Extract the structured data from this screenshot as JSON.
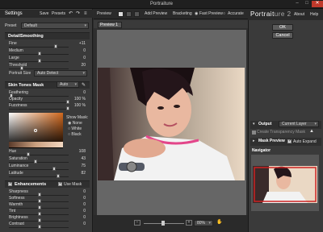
{
  "app": {
    "title": "Portraiture"
  },
  "left_panel": {
    "header": {
      "title": "Settings",
      "save": "Save",
      "presets": "Presets"
    },
    "preset": {
      "label": "Preset",
      "value": "Default"
    },
    "detail": {
      "title": "DetailSmoothing",
      "sliders": [
        {
          "name": "Fine",
          "value": "+11",
          "pos": 0.78
        },
        {
          "name": "Medium",
          "value": "0",
          "pos": 0.5
        },
        {
          "name": "Large",
          "value": "0",
          "pos": 0.5
        },
        {
          "name": "Threshold",
          "value": "20",
          "pos": 0.2
        }
      ],
      "portrait_size": {
        "label": "Portrait Size",
        "value": "Auto Detect"
      }
    },
    "skin": {
      "title": "Skin Tones Mask",
      "mode": "Auto",
      "sliders": [
        {
          "name": "Feathering",
          "value": "0",
          "pos": 0.02
        },
        {
          "name": "Opacity",
          "value": "100 %",
          "pos": 0.98
        },
        {
          "name": "Fuzziness",
          "value": "100 %",
          "pos": 0.98
        }
      ],
      "show_mask": {
        "label": "Show Mask:",
        "options": [
          "None",
          "White",
          "Black"
        ],
        "selected": 0
      },
      "hsl": [
        {
          "name": "Hue",
          "value": "108",
          "pos": 0.3
        },
        {
          "name": "Saturation",
          "value": "43",
          "pos": 0.43
        },
        {
          "name": "Luminance",
          "value": "75",
          "pos": 0.75
        },
        {
          "name": "Latitude",
          "value": "82",
          "pos": 0.82
        }
      ]
    },
    "enh": {
      "title": "Enhancements",
      "use_mask": "Use Mask",
      "sliders": [
        {
          "name": "Sharpness",
          "value": "0",
          "pos": 0.5
        },
        {
          "name": "Softness",
          "value": "0",
          "pos": 0.5
        },
        {
          "name": "Warmth",
          "value": "0",
          "pos": 0.5
        },
        {
          "name": "Tint",
          "value": "0",
          "pos": 0.5
        },
        {
          "name": "Brightness",
          "value": "0",
          "pos": 0.5
        },
        {
          "name": "Contrast",
          "value": "0",
          "pos": 0.5
        }
      ]
    }
  },
  "preview": {
    "label": "Preview",
    "add_preview": "Add Preview",
    "bracketing": "Bracketing",
    "fast_preview": "Fast Preview",
    "accurate": "Accurate",
    "tab": "Preview 1",
    "zoom": "80%"
  },
  "right_panel": {
    "brand_prefix": "Portrait",
    "brand_suffix": "ure 2",
    "about": "About",
    "help": "Help",
    "ok": "OK",
    "cancel": "Cancel",
    "output_label": "Output",
    "output_value": "Current Layer",
    "transparency": "Create Transparency Mask",
    "mask_preview": "Mask Preview",
    "auto_expand": "Auto Expand",
    "navigator": "Navigator"
  },
  "colors": {
    "accent": "#3b7fd1",
    "nav_frame": "#cc2222",
    "close": "#c0392b"
  }
}
